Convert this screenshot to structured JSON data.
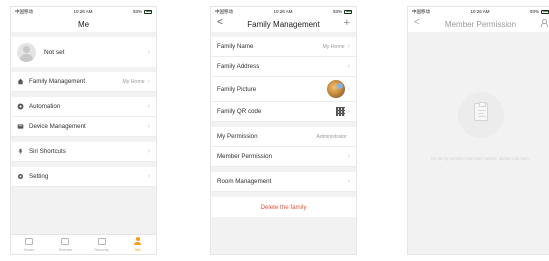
{
  "status_bar": {
    "carrier": "中国移动",
    "time": "10:26 AM",
    "battery": "93%"
  },
  "me_screen": {
    "title": "Me",
    "profile": {
      "name": "Not set"
    },
    "menu": {
      "family_management": {
        "label": "Family Management",
        "value": "My Home"
      },
      "automation": {
        "label": "Automation"
      },
      "device_management": {
        "label": "Device Management"
      },
      "siri_shortcuts": {
        "label": "Siri Shortcuts"
      },
      "setting": {
        "label": "Setting"
      }
    },
    "tabs": [
      {
        "label": "Home"
      },
      {
        "label": "Scenes"
      },
      {
        "label": "Security"
      },
      {
        "label": "Me"
      }
    ]
  },
  "family_screen": {
    "title": "Family Management",
    "back_glyph": "<",
    "add_glyph": "+",
    "rows": {
      "family_name": {
        "label": "Family Name",
        "value": "My Home"
      },
      "family_address": {
        "label": "Family Address"
      },
      "family_picture": {
        "label": "Family Picture"
      },
      "family_qr": {
        "label": "Family QR code"
      },
      "my_permission": {
        "label": "My Permission",
        "value": "Administrator"
      },
      "member_permission": {
        "label": "Member Permission"
      },
      "room_management": {
        "label": "Room Management"
      }
    },
    "delete_label": "Delete the family"
  },
  "member_screen": {
    "title": "Member Permission",
    "back_glyph": "<",
    "empty_text": "No family member has been added, please add them"
  },
  "colors": {
    "accent": "#f39c12",
    "danger": "#e6533c",
    "background": "#f2f2f2"
  },
  "icons": [
    "home-icon",
    "automation-icon",
    "device-icon",
    "siri-icon",
    "gear-icon",
    "qr-code-icon",
    "person-icon",
    "clipboard-icon"
  ]
}
